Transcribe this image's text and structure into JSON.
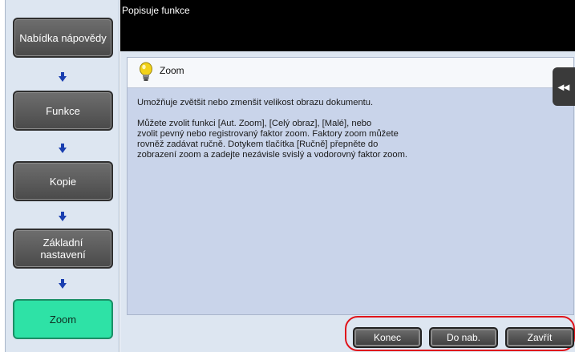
{
  "header": {
    "title": "Popisuje funkce"
  },
  "breadcrumb": {
    "items": [
      {
        "label": "Nabídka nápovědy"
      },
      {
        "label": "Funkce"
      },
      {
        "label": "Kopie"
      },
      {
        "label": "Základní nastavení"
      },
      {
        "label": "Zoom"
      }
    ]
  },
  "content": {
    "title": "Zoom",
    "paragraph1": "Umožňuje zvětšit nebo zmenšit velikost obrazu dokumentu.",
    "paragraph2": "Můžete zvolit funkci [Aut. Zoom], [Celý obraz], [Malé], nebo\nzvolit pevný nebo registrovaný faktor zoom. Faktory zoom můžete\nrovněž zadávat ručně. Dotykem tlačítka [Ručně] přepněte do\nzobrazení zoom a zadejte nezávisle svislý a vodorovný faktor zoom."
  },
  "side_tab": {
    "icon": "double-chevron-left-icon",
    "glyph": "◂◂"
  },
  "buttons": {
    "end": "Konec",
    "to_menu": "Do nab.",
    "close": "Zavřít"
  },
  "colors": {
    "active_crumb": "#2ee2a6",
    "highlight": "#e0141b",
    "arrow": "#1a3fb0"
  }
}
